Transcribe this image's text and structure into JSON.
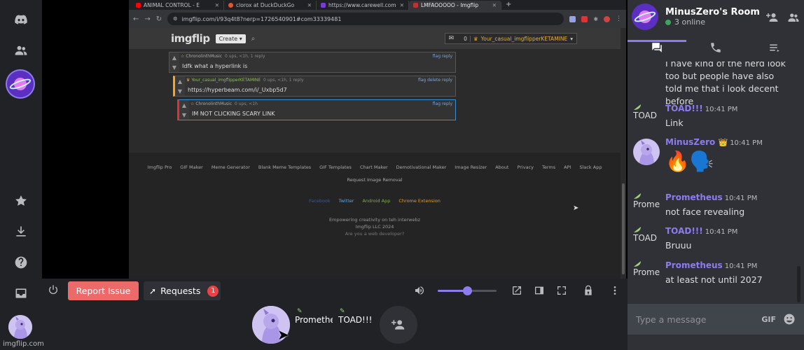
{
  "browser": {
    "tabs": [
      {
        "title": "ANIMAL CONTROL - E",
        "color": "#ff0000"
      },
      {
        "title": "clorox at DuckDuckGo",
        "color": "#de5833"
      },
      {
        "title": "https://www.carewell.com",
        "color": "#7a3cd6"
      },
      {
        "title": "LMFAOOOOO - Imgflip",
        "color": "#b33"
      }
    ],
    "url": "imgflip.com/i/93q4t8?nerp=1726540901#com33339481",
    "imgflip": {
      "logo": "imgflip",
      "create_label": "Create",
      "notif_count": "0",
      "username": "Your_casual_imgflipperKETAMINE"
    },
    "comments": [
      {
        "user": "ChronolinthMusic",
        "meta": "0 ups, <1h, 1 reply",
        "actions": "flag reply",
        "text": "Idfk what a hyperlink is"
      },
      {
        "user": "Your_casual_imgflipperKETAMINE",
        "meta": "0 ups, <1h, 1 reply",
        "actions": "flag delete reply",
        "text": "https://hyperbeam.com/i/_Uxbp5d7"
      },
      {
        "user": "ChronolinthMusic",
        "meta": "0 ups, <1h",
        "actions": "flag reply",
        "text": "IM NOT CLICKING SCARY LINK"
      }
    ],
    "footer": {
      "links": [
        "Imgflip Pro",
        "GIF Maker",
        "Meme Generator",
        "Blank Meme Templates",
        "GIF Templates",
        "Chart Maker",
        "Demotivational Maker",
        "Image Resizer",
        "About",
        "Privacy",
        "Terms",
        "API",
        "Slack App"
      ],
      "request_removal": "Request Image Removal",
      "social": [
        "Facebook",
        "Twitter",
        "Android App",
        "Chrome Extension"
      ],
      "tagline": "Empowering creativity on teh interwebz",
      "copyright": "Imgflip LLC 2024",
      "dev": "Are you a web developer?"
    }
  },
  "controls": {
    "report_label": "Report Issue",
    "requests_label": "Requests",
    "requests_count": "1",
    "volume": 0.5
  },
  "participants": [
    {
      "name": "Prometheus"
    },
    {
      "name": "TOAD!!!"
    }
  ],
  "watermark": "imgflip.com",
  "chat": {
    "room_title": "MinusZero's Room",
    "online": "3 online",
    "partial_text": "I have kind of the nerd look too but people have also told me that i look decent before",
    "messages": [
      {
        "user": "TOAD!!!",
        "time": "10:41 PM",
        "text": "Link",
        "avatar_text": "TOAD",
        "color": "#8c7cf0"
      },
      {
        "user": "MinusZero",
        "time": "10:41 PM",
        "text": "🔥🗣️",
        "crown": "👑",
        "color": "#8c7cf0"
      },
      {
        "user": "Prometheus",
        "time": "10:41 PM",
        "text": "not face revealing",
        "avatar_text": "Prome",
        "color": "#8c7cf0"
      },
      {
        "user": "TOAD!!!",
        "time": "10:41 PM",
        "text": "Bruuu",
        "avatar_text": "TOAD",
        "color": "#8c7cf0"
      },
      {
        "user": "Prometheus",
        "time": "10:41 PM",
        "text": "at least not until 2027",
        "avatar_text": "Prome",
        "color": "#8c7cf0"
      }
    ],
    "input_placeholder": "Type a message",
    "gif_label": "GIF"
  }
}
